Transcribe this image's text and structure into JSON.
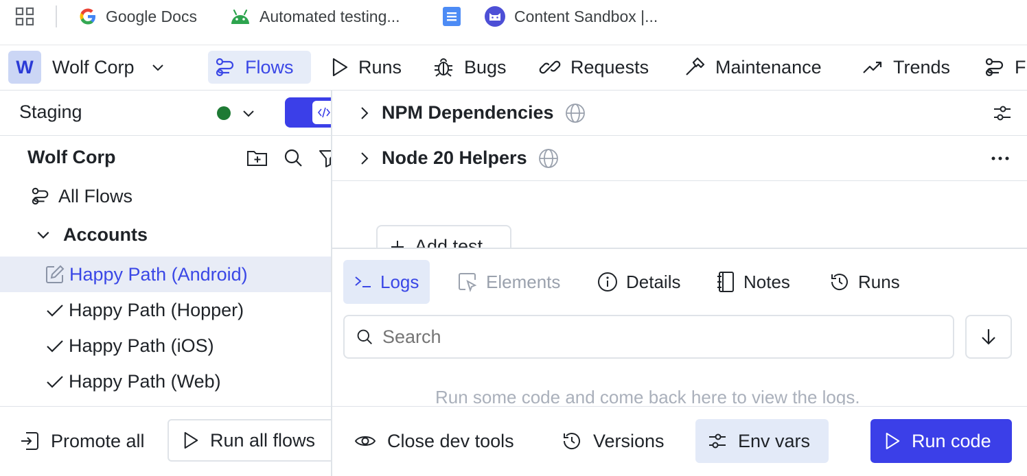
{
  "bookmarks": [
    {
      "label": "Google Docs",
      "icon": "google-icon"
    },
    {
      "label": "Automated testing...",
      "icon": "android-icon"
    },
    {
      "label": "",
      "icon": "docs-icon"
    },
    {
      "label": "Content Sandbox |...",
      "icon": "cat-icon"
    }
  ],
  "org": {
    "initial": "W",
    "name": "Wolf Corp"
  },
  "nav": {
    "flows": "Flows",
    "runs": "Runs",
    "bugs": "Bugs",
    "requests": "Requests",
    "maintenance": "Maintenance",
    "trends": "Trends",
    "cut": "F"
  },
  "env": {
    "name": "Staging",
    "status_color": "#1e7a34"
  },
  "tree": {
    "root": "Wolf Corp",
    "all_flows": "All Flows",
    "group": "Accounts",
    "items": [
      {
        "label": "Happy Path (Android)",
        "state": "editing"
      },
      {
        "label": "Happy Path (Hopper)",
        "state": "done"
      },
      {
        "label": "Happy Path (iOS)",
        "state": "done"
      },
      {
        "label": "Happy Path (Web)",
        "state": "done"
      }
    ]
  },
  "left_footer": {
    "promote": "Promote all",
    "run_all": "Run all flows"
  },
  "libraries": [
    {
      "name": "NPM Dependencies"
    },
    {
      "name": "Node 20 Helpers"
    }
  ],
  "add_test": "Add test",
  "devtools": {
    "tabs": {
      "logs": "Logs",
      "elements": "Elements",
      "details": "Details",
      "notes": "Notes",
      "runs": "Runs"
    },
    "search_placeholder": "Search",
    "empty_message": "Run some code and come back here to view the logs."
  },
  "footer": {
    "close_dev_tools": "Close dev tools",
    "versions": "Versions",
    "env_vars": "Env vars",
    "run_code": "Run code"
  },
  "colors": {
    "accent": "#3b3fe8",
    "active_bg": "#e6ecf8",
    "border": "#dfe3e8"
  }
}
